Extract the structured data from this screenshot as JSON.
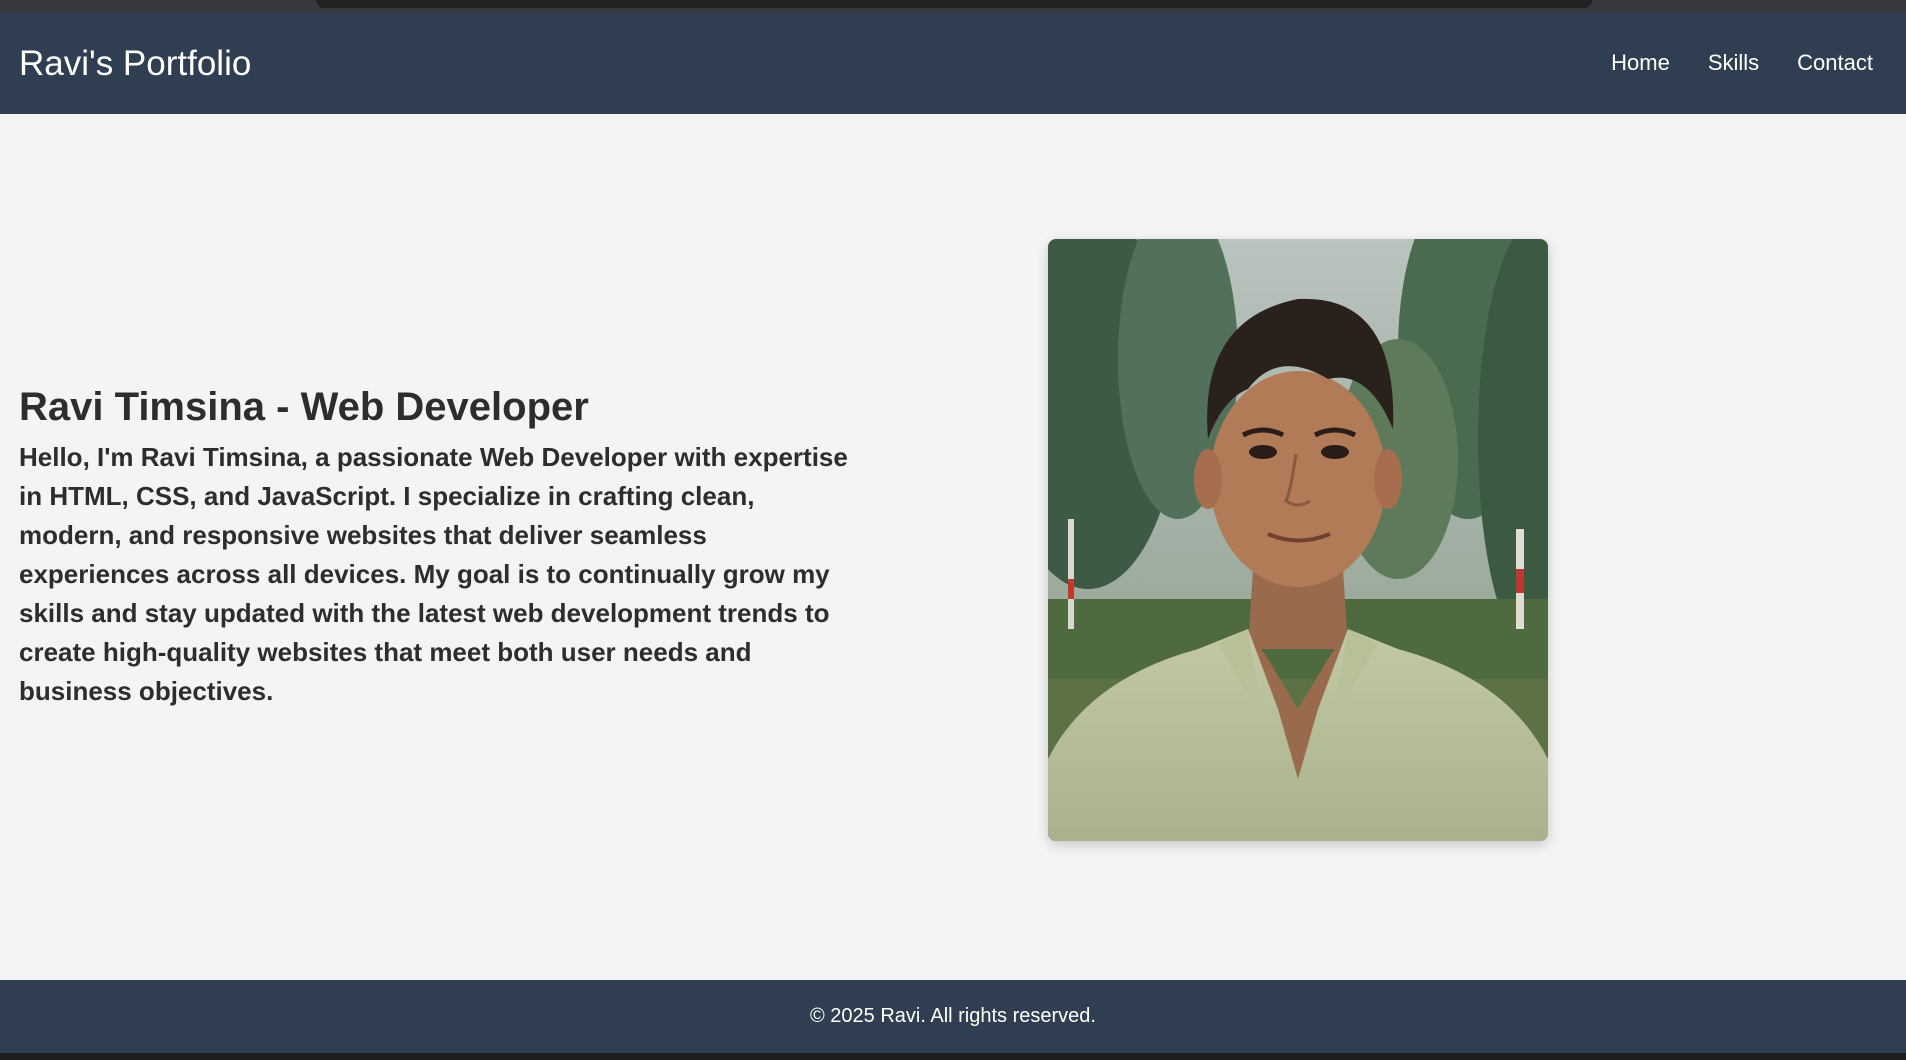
{
  "header": {
    "brand": "Ravi's Portfolio",
    "nav": [
      {
        "label": "Home"
      },
      {
        "label": "Skills"
      },
      {
        "label": "Contact"
      }
    ]
  },
  "intro": {
    "heading": "Ravi Timsina - Web Developer",
    "paragraph": "Hello, I'm Ravi Timsina, a passionate Web Developer with expertise in HTML, CSS, and JavaScript. I specialize in crafting clean, modern, and responsive websites that deliver seamless experiences across all devices. My goal is to continually grow my skills and stay updated with the latest web development trends to create high-quality websites that meet both user needs and business objectives."
  },
  "profile_image": {
    "icon": "profile-photo"
  },
  "footer": {
    "text": "© 2025 Ravi. All rights reserved."
  },
  "colors": {
    "header_bg": "#2f3e50",
    "page_bg": "#f4f4f4",
    "text": "#2d2d2d"
  }
}
